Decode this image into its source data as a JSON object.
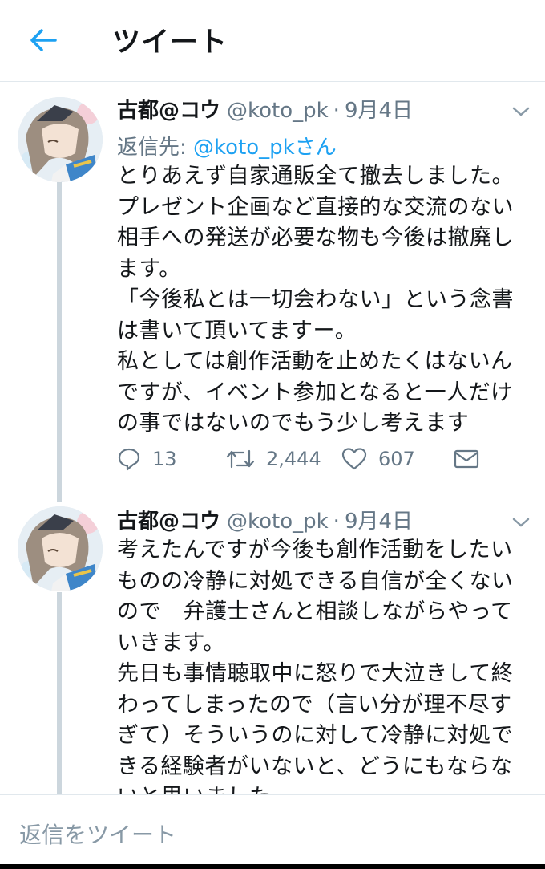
{
  "header": {
    "title": "ツイート"
  },
  "tweets": [
    {
      "name": "古都@コウ",
      "handle": "@koto_pk",
      "date": "9月4日",
      "reply_label": "返信先:",
      "reply_mention": "@koto_pkさん",
      "lines": [
        "とりあえず自家通販全て撤去しました。",
        "プレゼント企画など直接的な交流のない",
        "相手への発送が必要な物も今後は撤廃し",
        "ます。",
        "「今後私とは一切会わない」という念書",
        "は書いて頂いてますー。",
        "私としては創作活動を止めたくはないん",
        "ですが、イベント参加となると一人だけ",
        "の事ではないのでもう少し考えます"
      ],
      "replies": "13",
      "retweets": "2,444",
      "likes": "607"
    },
    {
      "name": "古都@コウ",
      "handle": "@koto_pk",
      "date": "9月4日",
      "lines": [
        "考えたんですが今後も創作活動をしたい",
        "ものの冷静に対処できる自信が全くない",
        "ので　弁護士さんと相談しながらやって",
        "いきます。",
        "先日も事情聴取中に怒りで大泣きして終",
        "わってしまったので（言い分が理不尽す",
        "ぎて）そういうのに対して冷静に対処で",
        "きる経験者がいないと、どうにもならな",
        "いと思いました。"
      ]
    }
  ],
  "compose": {
    "placeholder": "返信をツイート"
  },
  "icons": {
    "back": "back-arrow-icon",
    "reply": "reply-icon",
    "retweet": "retweet-icon",
    "like": "heart-icon",
    "dm": "envelope-icon",
    "more": "chevron-down-icon"
  },
  "colors": {
    "accent": "#1da1f2",
    "secondary_text": "#657786",
    "thread_line": "#ccd6dd"
  }
}
